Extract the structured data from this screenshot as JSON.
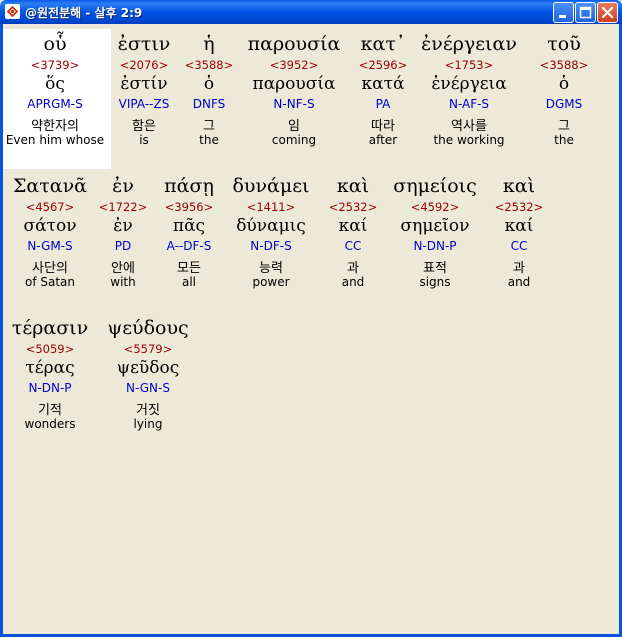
{
  "window": {
    "title": "@원전분해 - 살후 2:9",
    "buttons": [
      "minimize",
      "maximize",
      "close"
    ]
  },
  "rows": [
    [
      {
        "greek": "οὗ",
        "strong": "<3739>",
        "lemma": "ὅς",
        "morph": "APRGM-S",
        "korean": "약한자의",
        "english": "Even him whose",
        "selected": true
      },
      {
        "greek": "ἐστιν",
        "strong": "<2076>",
        "lemma": "ἐστίν",
        "morph": "VIPA--ZS",
        "korean": "함은",
        "english": "is"
      },
      {
        "greek": "ἡ",
        "strong": "<3588>",
        "lemma": "ὁ",
        "morph": "DNFS",
        "korean": "그",
        "english": "the"
      },
      {
        "greek": "παρουσία",
        "strong": "<3952>",
        "lemma": "παρουσία",
        "morph": "N-NF-S",
        "korean": "임",
        "english": "coming"
      },
      {
        "greek": "κατ᾽",
        "strong": "<2596>",
        "lemma": "κατά",
        "morph": "PA",
        "korean": "따라",
        "english": "after"
      },
      {
        "greek": "ἐνέργειαν",
        "strong": "<1753>",
        "lemma": "ἐνέργεια",
        "morph": "N-AF-S",
        "korean": "역사를",
        "english": "the working"
      },
      {
        "greek": "τοῦ",
        "strong": "<3588>",
        "lemma": "ὁ",
        "morph": "DGMS",
        "korean": "그",
        "english": "the"
      }
    ],
    [
      {
        "greek": "Σατανᾶ",
        "strong": "<4567>",
        "lemma": "σάτον",
        "morph": "N-GM-S",
        "korean": "사단의",
        "english": "of Satan"
      },
      {
        "greek": "ἐν",
        "strong": "<1722>",
        "lemma": "ἐν",
        "morph": "PD",
        "korean": "안에",
        "english": "with"
      },
      {
        "greek": "πάσῃ",
        "strong": "<3956>",
        "lemma": "πᾶς",
        "morph": "A--DF-S",
        "korean": "모든",
        "english": "all"
      },
      {
        "greek": "δυνάμει",
        "strong": "<1411>",
        "lemma": "δύναμις",
        "morph": "N-DF-S",
        "korean": "능력",
        "english": "power"
      },
      {
        "greek": "καὶ",
        "strong": "<2532>",
        "lemma": "καί",
        "morph": "CC",
        "korean": "과",
        "english": "and"
      },
      {
        "greek": "σημείοις",
        "strong": "<4592>",
        "lemma": "σημεῖον",
        "morph": "N-DN-P",
        "korean": "표적",
        "english": "signs"
      },
      {
        "greek": "καὶ",
        "strong": "<2532>",
        "lemma": "καί",
        "morph": "CC",
        "korean": "과",
        "english": "and"
      }
    ],
    [
      {
        "greek": "τέρασιν",
        "strong": "<5059>",
        "lemma": "τέρας",
        "morph": "N-DN-P",
        "korean": "기적",
        "english": "wonders"
      },
      {
        "greek": "ψεύδους",
        "strong": "<5579>",
        "lemma": "ψεῦδος",
        "morph": "N-GN-S",
        "korean": "거짓",
        "english": "lying"
      }
    ]
  ]
}
